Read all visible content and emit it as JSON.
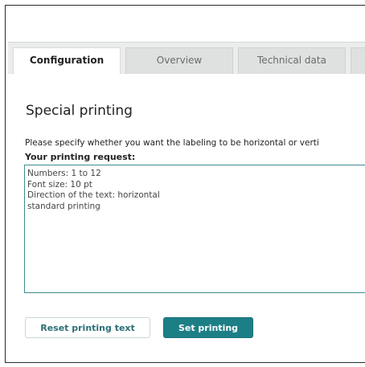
{
  "tabs": [
    {
      "label": "Configuration",
      "active": true
    },
    {
      "label": "Overview",
      "active": false
    },
    {
      "label": "Technical data",
      "active": false
    },
    {
      "label": "",
      "active": false
    }
  ],
  "section": {
    "heading": "Special printing",
    "description": "Please specify whether you want the labeling to be horizontal or verti",
    "request_label": "Your printing request:",
    "request_text": "Numbers: 1 to 12\nFont size: 10 pt\nDirection of the text: horizontal\nstandard printing"
  },
  "buttons": {
    "reset_label": "Reset printing text",
    "set_label": "Set printing"
  },
  "colors": {
    "accent": "#1d7f86",
    "textarea_border": "#3f8d8d",
    "tabbar_bg": "#ebedec"
  }
}
